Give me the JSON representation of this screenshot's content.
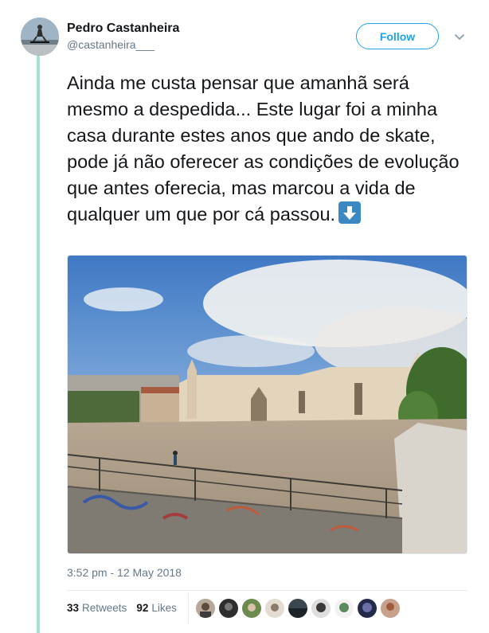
{
  "tweet": {
    "author_name": "Pedro Castanheira",
    "author_handle": "@castanheira___",
    "follow_label": "Follow",
    "text": "Ainda me custa pensar que amanhã será mesmo a despedida... Este lugar foi a minha casa durante estes anos que ando de skate, pode já não oferecer as condições de evolução que antes oferecia, mas marcou a vida de qualquer um que por cá passou.",
    "timestamp": "3:52 pm - 12 May 2018",
    "retweets_count": "33",
    "retweets_label": "Retweets",
    "likes_count": "92",
    "likes_label": "Likes"
  },
  "icons": {
    "more": "chevron-down-icon",
    "emoji": "down-arrow-emoji-icon"
  },
  "colors": {
    "accent": "#1da1f2",
    "thread_line": "#a6e4ce",
    "secondary_text": "#657786",
    "emoji_blue": "#3b88c3"
  }
}
